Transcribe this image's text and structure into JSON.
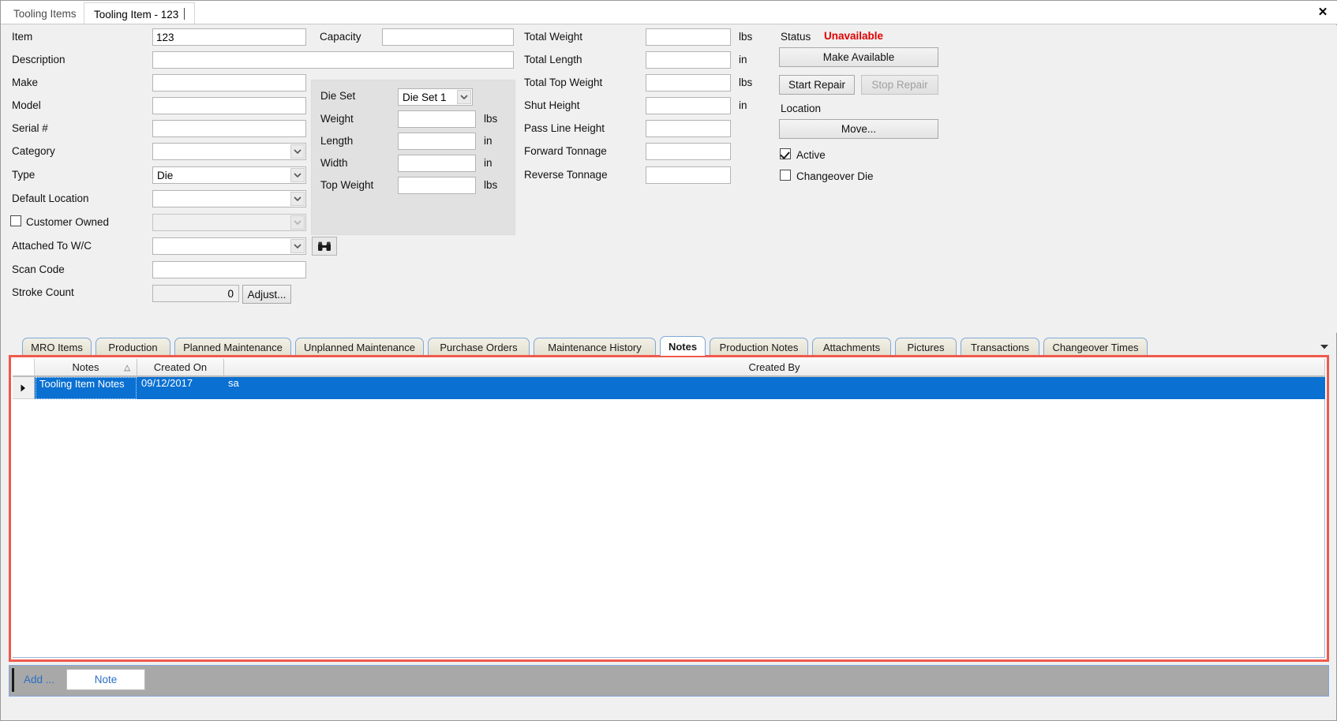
{
  "window": {
    "tabs": [
      {
        "label": "Tooling Items",
        "active": false
      },
      {
        "label": "Tooling Item - 123",
        "active": true
      }
    ],
    "close_icon": "close-icon"
  },
  "form": {
    "fields": {
      "item": {
        "label": "Item",
        "value": "123",
        "placeholder": ""
      },
      "description": {
        "label": "Description",
        "value": "",
        "placeholder": ""
      },
      "make": {
        "label": "Make",
        "value": "",
        "placeholder": ""
      },
      "model": {
        "label": "Model",
        "value": "",
        "placeholder": ""
      },
      "serial": {
        "label": "Serial #",
        "value": "",
        "placeholder": ""
      },
      "category": {
        "label": "Category",
        "value": ""
      },
      "type": {
        "label": "Type",
        "value": "Die"
      },
      "default_location": {
        "label": "Default Location",
        "value": ""
      },
      "customer_owned": {
        "label": "Customer Owned",
        "checked": false,
        "value": ""
      },
      "attached_to_wc": {
        "label": "Attached To W/C",
        "value": ""
      },
      "scan_code": {
        "label": "Scan Code",
        "value": "",
        "placeholder": ""
      },
      "stroke_count": {
        "label": "Stroke Count",
        "value": "0",
        "adjust_label": "Adjust..."
      }
    },
    "dieset": {
      "die_set": {
        "label": "Die Set",
        "value": "Die Set 1"
      },
      "weight": {
        "label": "Weight",
        "value": "",
        "unit": "lbs"
      },
      "length": {
        "label": "Length",
        "value": "",
        "unit": "in"
      },
      "width": {
        "label": "Width",
        "value": "",
        "unit": "in"
      },
      "top_weight": {
        "label": "Top Weight",
        "value": "",
        "unit": "lbs"
      }
    },
    "capacity": {
      "label": "Capacity",
      "value": ""
    },
    "totals": {
      "total_weight": {
        "label": "Total Weight",
        "value": "",
        "unit": "lbs"
      },
      "total_length": {
        "label": "Total Length",
        "value": "",
        "unit": "in"
      },
      "total_top_weight": {
        "label": "Total Top Weight",
        "value": "",
        "unit": "lbs"
      },
      "shut_height": {
        "label": "Shut Height",
        "value": "",
        "unit": "in"
      },
      "pass_line_height": {
        "label": "Pass Line Height",
        "value": "",
        "unit": ""
      },
      "forward_tonnage": {
        "label": "Forward Tonnage",
        "value": "",
        "unit": ""
      },
      "reverse_tonnage": {
        "label": "Reverse Tonnage",
        "value": "",
        "unit": ""
      }
    },
    "status": {
      "label": "Status",
      "value": "Unavailable",
      "value_color": "#e00000",
      "make_available_label": "Make Available",
      "start_repair_label": "Start Repair",
      "stop_repair_label": "Stop Repair",
      "location_label": "Location",
      "move_label": "Move...",
      "active": {
        "label": "Active",
        "checked": true
      },
      "changeover_die": {
        "label": "Changeover Die",
        "checked": false
      }
    }
  },
  "bottom_tabs": [
    {
      "label": "MRO Items",
      "active": false
    },
    {
      "label": "Production",
      "active": false
    },
    {
      "label": "Planned Maintenance",
      "active": false
    },
    {
      "label": "Unplanned Maintenance",
      "active": false
    },
    {
      "label": "Purchase Orders",
      "active": false
    },
    {
      "label": "Maintenance History",
      "active": false
    },
    {
      "label": "Notes",
      "active": true
    },
    {
      "label": "Production Notes",
      "active": false
    },
    {
      "label": "Attachments",
      "active": false
    },
    {
      "label": "Pictures",
      "active": false
    },
    {
      "label": "Transactions",
      "active": false
    },
    {
      "label": "Changeover Times",
      "active": false
    }
  ],
  "grid": {
    "columns": [
      {
        "label": "Notes",
        "sorted": "asc"
      },
      {
        "label": "Created On",
        "sorted": ""
      },
      {
        "label": "Created By",
        "sorted": ""
      }
    ],
    "rows": [
      {
        "notes": "Tooling Item Notes",
        "created_on": "09/12/2017",
        "created_by": "sa",
        "selected": true
      }
    ]
  },
  "footer": {
    "add_label": "Add ...",
    "note_label": "Note"
  },
  "colors": {
    "selection_blue": "#0a70d2",
    "highlight_red": "#f0594d",
    "link_blue": "#2a6fc4",
    "status_red": "#e00000"
  }
}
